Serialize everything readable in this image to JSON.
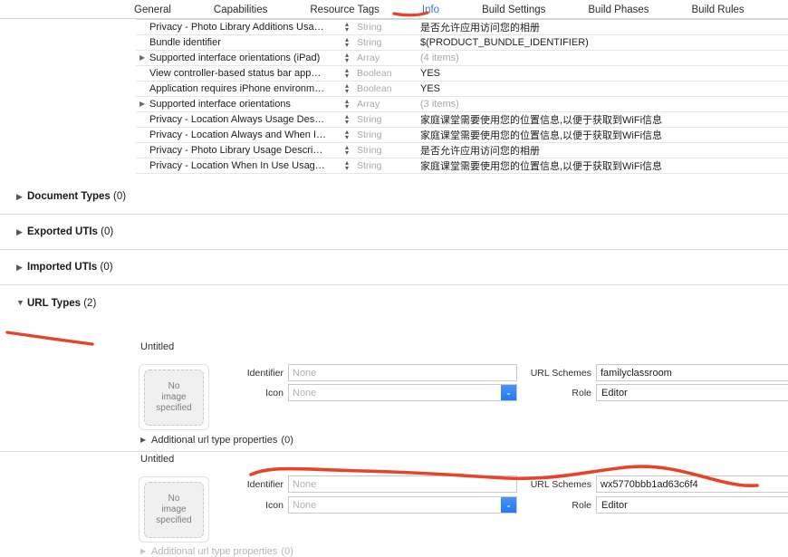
{
  "tabs": [
    {
      "label": "General",
      "selected": false
    },
    {
      "label": "Capabilities",
      "selected": false
    },
    {
      "label": "Resource Tags",
      "selected": false
    },
    {
      "label": "Info",
      "selected": true
    },
    {
      "label": "Build Settings",
      "selected": false
    },
    {
      "label": "Build Phases",
      "selected": false
    },
    {
      "label": "Build Rules",
      "selected": false
    }
  ],
  "plist": {
    "rows": [
      {
        "key": "Privacy - Photo Library Additions Usa…",
        "expandable": false,
        "type": "String",
        "value": "是否允许应用访问您的相册",
        "muted": false
      },
      {
        "key": "Bundle identifier",
        "expandable": false,
        "type": "String",
        "value": "$(PRODUCT_BUNDLE_IDENTIFIER)",
        "muted": false
      },
      {
        "key": "Supported interface orientations (iPad)",
        "expandable": true,
        "type": "Array",
        "value": "(4 items)",
        "muted": true
      },
      {
        "key": "View controller-based status bar app…",
        "expandable": false,
        "type": "Boolean",
        "value": "YES",
        "muted": false
      },
      {
        "key": "Application requires iPhone environm…",
        "expandable": false,
        "type": "Boolean",
        "value": "YES",
        "muted": false
      },
      {
        "key": "Supported interface orientations",
        "expandable": true,
        "type": "Array",
        "value": "(3 items)",
        "muted": true
      },
      {
        "key": "Privacy - Location Always Usage Des…",
        "expandable": false,
        "type": "String",
        "value": "家庭课堂需要使用您的位置信息,以便于获取到WiFi信息",
        "muted": false
      },
      {
        "key": "Privacy - Location Always and When I…",
        "expandable": false,
        "type": "String",
        "value": "家庭课堂需要使用您的位置信息,以便于获取到WiFi信息",
        "muted": false
      },
      {
        "key": "Privacy - Photo Library Usage Descri…",
        "expandable": false,
        "type": "String",
        "value": "是否允许应用访问您的相册",
        "muted": false
      },
      {
        "key": "Privacy - Location When In Use Usag…",
        "expandable": false,
        "type": "String",
        "value": "家庭课堂需要使用您的位置信息,以便于获取到WiFi信息",
        "muted": false
      }
    ],
    "stepper_up": "▴",
    "stepper_down": "▾"
  },
  "sections": [
    {
      "title": "Document Types",
      "count": "(0)",
      "expanded": false
    },
    {
      "title": "Exported UTIs",
      "count": "(0)",
      "expanded": false
    },
    {
      "title": "Imported UTIs",
      "count": "(0)",
      "expanded": false
    },
    {
      "title": "URL Types",
      "count": "(2)",
      "expanded": true
    }
  ],
  "disclosure": {
    "collapsed": "▶",
    "expanded": "▼"
  },
  "url_types": [
    {
      "name": "Untitled",
      "image_well": {
        "line1": "No",
        "line2": "image",
        "line3": "specified"
      },
      "identifier_label": "Identifier",
      "identifier_value": "",
      "identifier_placeholder": "None",
      "icon_label": "Icon",
      "icon_value": "",
      "icon_placeholder": "None",
      "url_schemes_label": "URL Schemes",
      "url_schemes_value": "familyclassroom",
      "role_label": "Role",
      "role_value": "Editor",
      "additional_label": "Additional url type properties",
      "additional_count": "(0)"
    },
    {
      "name": "Untitled",
      "image_well": {
        "line1": "No",
        "line2": "image",
        "line3": "specified"
      },
      "identifier_label": "Identifier",
      "identifier_value": "",
      "identifier_placeholder": "None",
      "icon_label": "Icon",
      "icon_value": "",
      "icon_placeholder": "None",
      "url_schemes_label": "URL Schemes",
      "url_schemes_value": "wx5770bbb1ad63c6f4",
      "role_label": "Role",
      "role_value": "Editor",
      "additional_label": "Additional url type properties",
      "additional_count": "(0)"
    }
  ],
  "popup_chevron": "⌄",
  "colors": {
    "selected_tab": "#3a6fd8",
    "annotation": "#e8432a",
    "popup_button": "#2479f3"
  }
}
